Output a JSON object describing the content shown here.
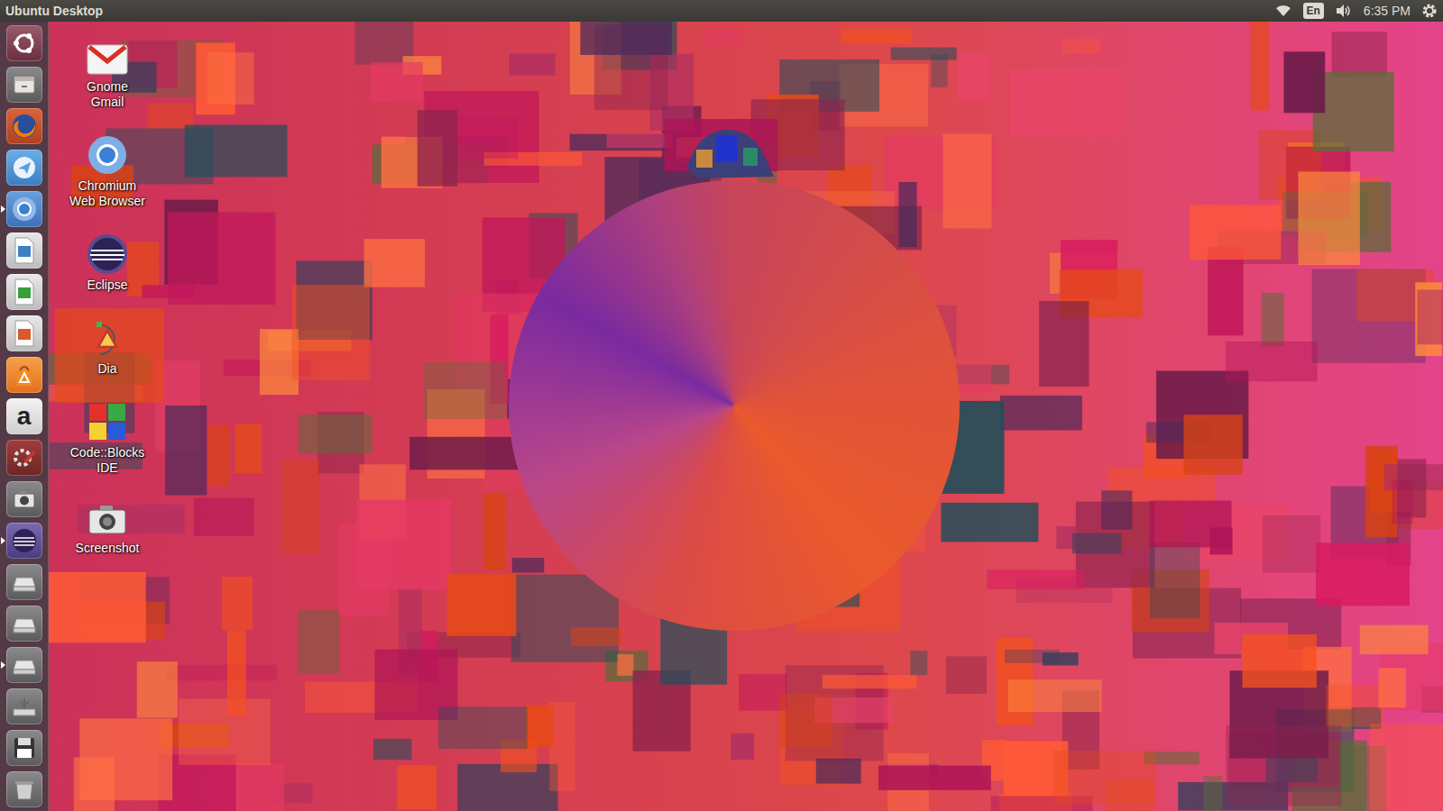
{
  "top_bar": {
    "title": "Ubuntu Desktop",
    "keyboard": "En",
    "clock": "6:35 PM"
  },
  "launcher": [
    {
      "kind": "dash",
      "running": false
    },
    {
      "kind": "files",
      "running": false
    },
    {
      "kind": "firefox",
      "running": false
    },
    {
      "kind": "messenger",
      "running": false
    },
    {
      "kind": "chromium",
      "running": true
    },
    {
      "kind": "writer",
      "running": false
    },
    {
      "kind": "calc",
      "running": false
    },
    {
      "kind": "impress",
      "running": false
    },
    {
      "kind": "software",
      "running": false
    },
    {
      "kind": "amazon",
      "running": false,
      "glyph": "a"
    },
    {
      "kind": "settings",
      "running": false
    },
    {
      "kind": "camera",
      "running": false
    },
    {
      "kind": "eclipse",
      "running": true
    },
    {
      "kind": "drive",
      "running": false
    },
    {
      "kind": "drive",
      "running": false
    },
    {
      "kind": "drive",
      "running": true
    },
    {
      "kind": "usb",
      "running": false
    },
    {
      "kind": "floppy",
      "running": false
    },
    {
      "kind": "trash",
      "running": false
    }
  ],
  "desktop_icons": [
    {
      "label": "Gnome Gmail",
      "kind": "gmail"
    },
    {
      "label": "Chromium Web Browser",
      "kind": "chromium"
    },
    {
      "label": "Eclipse",
      "kind": "eclipse"
    },
    {
      "label": "Dia",
      "kind": "dia"
    },
    {
      "label": "Code::Blocks IDE",
      "kind": "codeblocks"
    },
    {
      "label": "Screenshot",
      "kind": "camera"
    }
  ]
}
